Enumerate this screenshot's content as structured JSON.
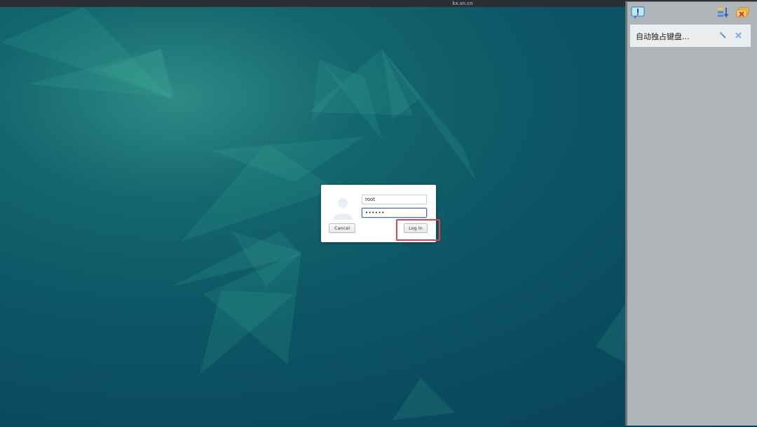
{
  "window": {
    "title": "kx.sn.cn"
  },
  "login": {
    "username": "root",
    "password_masked": "••••••",
    "cancel_label": "Cancel",
    "login_label": "Log In"
  },
  "side_panel": {
    "item_label": "自动独占键盘..."
  },
  "colors": {
    "highlight": "#e0444a",
    "focus": "#2f6fd0",
    "panel": "#aeb4b7"
  }
}
